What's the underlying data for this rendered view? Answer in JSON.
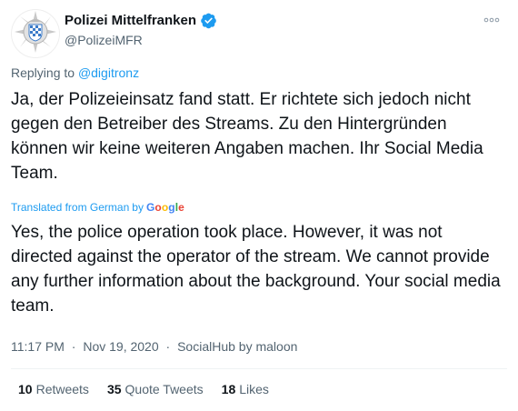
{
  "tweet": {
    "author": {
      "name": "Polizei Mittelfranken",
      "handle": "@PolizeiMFR",
      "avatar_icon": "police-star-badge-icon",
      "verified_icon": "verified-badge-icon"
    },
    "more_icon": "more-options-icon",
    "replying_prefix": "Replying to",
    "replying_to": "@digitronz",
    "text_original": "Ja, der Polizeieinsatz fand statt. Er richtete sich jedoch nicht gegen den Betreiber des Streams. Zu den Hintergründen können wir keine weiteren Angaben machen. Ihr Social Media Team.",
    "translation_label": "Translated from German",
    "translation_by": "by",
    "translation_provider": "Google",
    "text_translated": "Yes, the police operation took place. However, it was not directed against the operator of the stream. We cannot provide any further information about the background. Your social media team.",
    "time": "11:17 PM",
    "date": "Nov 19, 2020",
    "separator": "·",
    "source": "SocialHub by maloon",
    "stats": [
      {
        "count": "10",
        "label": "Retweets"
      },
      {
        "count": "35",
        "label": "Quote Tweets"
      },
      {
        "count": "18",
        "label": "Likes"
      }
    ]
  },
  "colors": {
    "link": "#1d9bf0",
    "text": "#0f1419",
    "secondary": "#536471",
    "divider": "#eff3f4",
    "avatar_blue": "#3d7cc9"
  }
}
